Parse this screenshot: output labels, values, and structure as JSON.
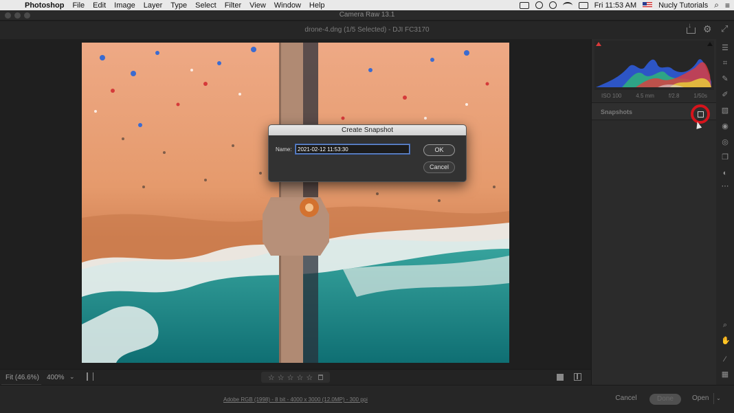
{
  "menubar": {
    "apple_icon": "apple-icon",
    "app_name": "Photoshop",
    "menus": [
      "File",
      "Edit",
      "Image",
      "Layer",
      "Type",
      "Select",
      "Filter",
      "View",
      "Window",
      "Help"
    ],
    "clock": "Fri 11:53 AM",
    "user": "Nucly Tutorials"
  },
  "window": {
    "title": "Camera Raw 13.1"
  },
  "document": {
    "filename": "drone-4.dng (1/5 Selected)  -  DJI FC3170"
  },
  "canvasbar": {
    "zoom_fit": "Fit (46.6%)",
    "zoom_level": "400%",
    "stars": [
      "☆",
      "☆",
      "☆",
      "☆",
      "☆"
    ]
  },
  "histogram": {
    "exif": [
      "ISO 100",
      "4.5 mm",
      "f/2.8",
      "1/50s"
    ]
  },
  "snapshots": {
    "title": "Snapshots"
  },
  "dialog": {
    "title": "Create Snapshot",
    "name_label": "Name:",
    "name_value": "2021-02-12 11:53:30",
    "ok_label": "OK",
    "cancel_label": "Cancel"
  },
  "bottombar": {
    "workflow": "Adobe RGB (1998) - 8 bit - 4000 x 3000 (12.0MP) - 300 ppi",
    "cancel_label": "Cancel",
    "done_label": "Done",
    "open_label": "Open"
  },
  "colors": {
    "accent_highlight": "#d5141c",
    "sand": "#e9a37a",
    "water": "#1e8f8a"
  }
}
